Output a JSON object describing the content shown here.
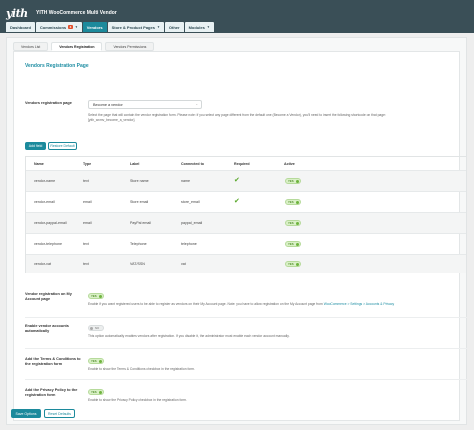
{
  "header": {
    "logo": "yith",
    "title": "YITH WooCommerce Multi Vendor"
  },
  "nav": {
    "items": [
      {
        "label": "Dashboard"
      },
      {
        "label": "Commissions",
        "badge": "3"
      },
      {
        "label": "Vendors"
      },
      {
        "label": "Store & Product Pages"
      },
      {
        "label": "Other"
      },
      {
        "label": "Modules"
      }
    ]
  },
  "subtabs": [
    {
      "label": "Vendors List"
    },
    {
      "label": "Vendors Registration"
    },
    {
      "label": "Vendors Permissions"
    }
  ],
  "section": {
    "title": "Vendors Registration Page"
  },
  "registration_page": {
    "label": "Vendors registration page",
    "value": "Become a vendor",
    "description_1": "Select the page that will contain the vendor registration form. Please note: if you select any page different from the default one (Become a Vendor), you'll need to insert the following shortcode on that page:",
    "description_2": "[yith_wcmv_become_a_vendor]."
  },
  "buttons": {
    "add_field": "Add field",
    "restore_default": "Restore Default",
    "save_options": "Save Options",
    "reset_defaults": "Reset Defaults"
  },
  "table": {
    "headers": [
      "Name",
      "Type",
      "Label",
      "Connected to",
      "Required",
      "Active"
    ],
    "rows": [
      {
        "name": "vendor-name",
        "type": "text",
        "label": "Store name",
        "connected": "name",
        "required": true,
        "active": "YES"
      },
      {
        "name": "vendor-email",
        "type": "email",
        "label": "Store email",
        "connected": "store_email",
        "required": true,
        "active": "YES"
      },
      {
        "name": "vendor-paypal-email",
        "type": "email",
        "label": "PayPal email",
        "connected": "paypal_email",
        "required": false,
        "active": "YES"
      },
      {
        "name": "vendor-telephone",
        "type": "text",
        "label": "Telephone",
        "connected": "telephone",
        "required": false,
        "active": "YES"
      },
      {
        "name": "vendor-vat",
        "type": "text",
        "label": "VAT/SSN",
        "connected": "vat",
        "required": false,
        "active": "YES"
      }
    ]
  },
  "settings": {
    "my_account": {
      "label_1": "Vendor registration on My",
      "label_2": "Account page",
      "toggle": "YES",
      "desc_pre": "Enable if you want registered users to be able to register as vendors on their My Account page. Note: you have to allow registration on the My Account page from",
      "desc_link": "WooCommerce > Settings > Accounts & Privacy"
    },
    "auto_enable": {
      "label_1": "Enable vendor accounts",
      "label_2": "automatically",
      "toggle": "NO",
      "desc": "This option automatically enables vendors after registration. If you disable it, the administrator must enable each vendor account manually."
    },
    "terms": {
      "label_1": "Add the Terms & Conditions to",
      "label_2": "the registration form",
      "toggle": "YES",
      "desc": "Enable to show the Terms & Conditions checkbox in the registration form."
    },
    "privacy": {
      "label_1": "Add the Privacy Policy to the",
      "label_2": "registration form",
      "toggle": "YES",
      "desc": "Enable to show the Privacy Policy checkbox in the registration form."
    }
  },
  "colors": {
    "accent": "#1c8a9c",
    "header_bg": "#3a4f57",
    "badge": "#e2502d",
    "check": "#59a82a"
  }
}
